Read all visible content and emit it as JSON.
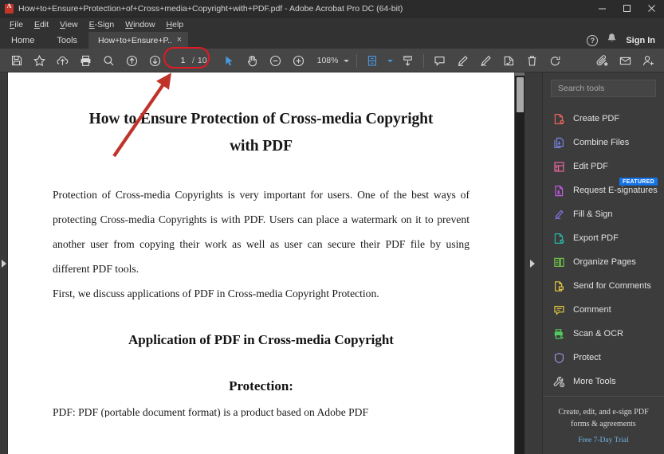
{
  "window": {
    "title": "How+to+Ensure+Protection+of+Cross+media+Copyright+with+PDF.pdf - Adobe Acrobat Pro DC (64-bit)",
    "app_icon": "adobe-acrobat-icon",
    "minimize": "–",
    "maximize": "❐",
    "close": "✕"
  },
  "menubar": {
    "items": [
      {
        "label": "File",
        "mnemonic": "F"
      },
      {
        "label": "Edit",
        "mnemonic": "E"
      },
      {
        "label": "View",
        "mnemonic": "V"
      },
      {
        "label": "E-Sign",
        "mnemonic": "E"
      },
      {
        "label": "Window",
        "mnemonic": "W"
      },
      {
        "label": "Help",
        "mnemonic": "H"
      }
    ]
  },
  "tabbar": {
    "home": "Home",
    "tools": "Tools",
    "document_tab": "How+to+Ensure+P...",
    "close_glyph": "×",
    "help_glyph": "?",
    "sign_in": "Sign In"
  },
  "toolbar": {
    "buttons": [
      "save-icon",
      "add-to-favorites-icon",
      "upload-cloud-icon",
      "print-icon",
      "zoom-search-icon",
      "previous-page-icon",
      "next-page-icon"
    ],
    "page_current": "1",
    "page_separator": "/",
    "page_total": "10",
    "select_tool": "select-cursor-icon",
    "hand_tool": "hand-tool-icon",
    "zoom_out": "zoom-out-icon",
    "zoom_in": "zoom-in-icon",
    "zoom_level": "108%",
    "fit_page": "fit-page-icon",
    "scroll_mode": "page-scroll-icon",
    "right_buttons": [
      "add-comment-icon",
      "highlight-icon",
      "draw-icon",
      "stamp-icon",
      "delete-icon",
      "rotate-icon",
      "attach-file-icon",
      "email-icon",
      "share-person-icon"
    ]
  },
  "document": {
    "title_line1": "How to Ensure Protection of Cross-media Copyright",
    "title_line2": "with PDF",
    "paragraph1": "Protection of Cross-media Copyrights is very important for users. One of the best ways of protecting Cross-media Copyrights is with PDF. Users can place a watermark on it to prevent another user from copying their work as well as user can secure their PDF file by using different PDF tools.",
    "paragraph2": "First, we discuss applications of PDF in Cross-media Copyright Protection.",
    "heading2_line1": "Application of PDF in Cross-media Copyright",
    "heading2_line2": "Protection:",
    "cut_line": "PDF: PDF (portable document format) is a product based on Adobe PDF"
  },
  "tools_panel": {
    "search_placeholder": "Search tools",
    "search_value": "",
    "featured_badge": "FEATURED",
    "items": [
      {
        "label": "Create PDF",
        "icon": "create-pdf-icon",
        "color": "#e8645a"
      },
      {
        "label": "Combine Files",
        "icon": "combine-files-icon",
        "color": "#7b83e8"
      },
      {
        "label": "Edit PDF",
        "icon": "edit-pdf-icon",
        "color": "#e8679e"
      },
      {
        "label": "Request E-signatures",
        "icon": "request-esignatures-icon",
        "color": "#c05ce0",
        "badge": "FEATURED"
      },
      {
        "label": "Fill & Sign",
        "icon": "fill-and-sign-icon",
        "color": "#8c6fe0"
      },
      {
        "label": "Export PDF",
        "icon": "export-pdf-icon",
        "color": "#2bb3a3"
      },
      {
        "label": "Organize Pages",
        "icon": "organize-pages-icon",
        "color": "#6fc24a"
      },
      {
        "label": "Send for Comments",
        "icon": "send-for-comments-icon",
        "color": "#e0c640"
      },
      {
        "label": "Comment",
        "icon": "comment-icon",
        "color": "#e0c640"
      },
      {
        "label": "Scan & OCR",
        "icon": "scan-and-ocr-icon",
        "color": "#55c95e"
      },
      {
        "label": "Protect",
        "icon": "protect-shield-icon",
        "color": "#a18ce0"
      },
      {
        "label": "More Tools",
        "icon": "more-tools-icon",
        "color": "#c8c8c8"
      }
    ],
    "promo_line1": "Create, edit, and e-sign PDF",
    "promo_line2": "forms & agreements",
    "promo_link": "Free 7-Day Trial"
  },
  "annotations": {
    "highlight_color": "#e01b24",
    "arrow_color": "#c0332b",
    "highlight_target": "page-number-field",
    "arrow_points_to": "page-number-field"
  },
  "colors": {
    "titlebar_bg": "#2b2b2b",
    "chrome_bg": "#323232",
    "toolbar_bg": "#464646",
    "panel_bg": "#3c3c3c",
    "accent_blue": "#1473e6",
    "page_bg": "#ffffff"
  }
}
